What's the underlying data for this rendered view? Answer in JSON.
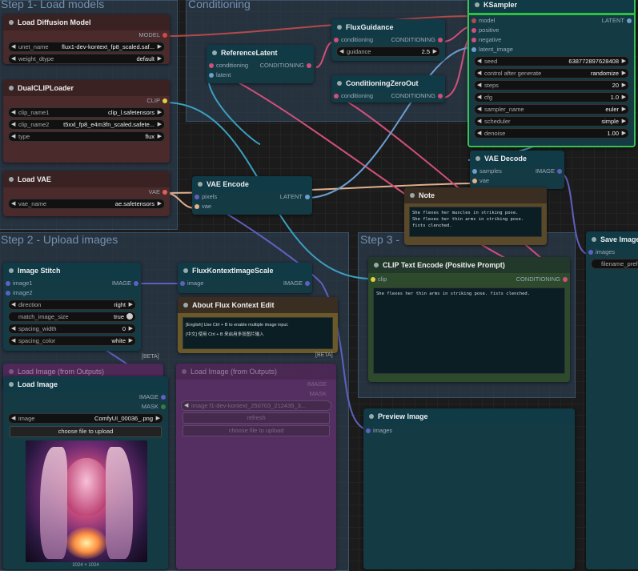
{
  "groups": {
    "step1": "Step 1- Load models",
    "conditioning": "Conditioning",
    "step2": "Step 2 - Upload images",
    "step3": "Step 3 -"
  },
  "load_diffusion": {
    "title": "Load Diffusion Model",
    "out": "MODEL",
    "unet_label": "unet_name",
    "unet_value": "flux1-dev-kontext_fp8_scaled.saf...",
    "dtype_label": "weight_dtype",
    "dtype_value": "default"
  },
  "dual_clip": {
    "title": "DualCLIPLoader",
    "out": "CLIP",
    "clip1_label": "clip_name1",
    "clip1_value": "clip_l.safetensors",
    "clip2_label": "clip_name2",
    "clip2_value": "t5xxl_fp8_e4m3fn_scaled.safete...",
    "type_label": "type",
    "type_value": "flux"
  },
  "load_vae": {
    "title": "Load VAE",
    "out": "VAE",
    "vae_label": "vae_name",
    "vae_value": "ae.safetensors"
  },
  "reference_latent": {
    "title": "ReferenceLatent",
    "in1": "conditioning",
    "in2": "latent",
    "out": "CONDITIONING"
  },
  "flux_guidance": {
    "title": "FluxGuidance",
    "in": "conditioning",
    "out": "CONDITIONING",
    "g_label": "guidance",
    "g_value": "2.5"
  },
  "cond_zero": {
    "title": "ConditioningZeroOut",
    "in": "conditioning",
    "out": "CONDITIONING"
  },
  "ksampler": {
    "title": "KSampler",
    "in_model": "model",
    "in_pos": "positive",
    "in_neg": "negative",
    "in_latent": "latent_image",
    "out": "LATENT",
    "widgets": [
      {
        "label": "seed",
        "value": "638772897628408"
      },
      {
        "label": "control after generate",
        "value": "randomize"
      },
      {
        "label": "steps",
        "value": "20"
      },
      {
        "label": "cfg",
        "value": "1.0"
      },
      {
        "label": "sampler_name",
        "value": "euler"
      },
      {
        "label": "scheduler",
        "value": "simple"
      },
      {
        "label": "denoise",
        "value": "1.00"
      }
    ]
  },
  "vae_encode": {
    "title": "VAE Encode",
    "in1": "pixels",
    "in2": "vae",
    "out": "LATENT"
  },
  "vae_decode": {
    "title": "VAE Decode",
    "in1": "samples",
    "in2": "vae",
    "out": "IMAGE"
  },
  "note": {
    "title": "Note",
    "text": "She flexes her muscles in striking pose.\nShe flexes her thin arms in striking pose.\nfists clenched."
  },
  "save_image": {
    "title": "Save Image",
    "in": "images",
    "prefix_label": "filename_prefi"
  },
  "image_stitch": {
    "title": "Image Stitch",
    "in1": "image1",
    "in2": "image2",
    "out": "IMAGE",
    "direction_label": "direction",
    "direction_value": "right",
    "match_label": "match_image_size",
    "match_value": "true",
    "spacing_label": "spacing_width",
    "spacing_value": "0",
    "color_label": "spacing_color",
    "color_value": "white",
    "beta": "[BETA]"
  },
  "flux_scale": {
    "title": "FluxKontextImageScale",
    "in": "image",
    "out": "IMAGE"
  },
  "about": {
    "title": "About Flux Kontext Edit",
    "line1": "[English] Use Ctrl + B to enable multiple image input.",
    "line2": "[中文] 使用 Ctrl + B 来启用多张图片输入",
    "beta": "[BETA]"
  },
  "clip_text": {
    "title": "CLIP Text Encode (Positive Prompt)",
    "in": "clip",
    "out": "CONDITIONING",
    "text": "She flexes her thin arms in striking pose. fists clenched."
  },
  "load_image_outputs_1": {
    "title": "Load Image (from Outputs)"
  },
  "load_image_outputs_2": {
    "title": "Load Image (from Outputs)",
    "out1": "IMAGE",
    "out2": "MASK",
    "image_label": "image",
    "image_value": "f1-dev-kontext_250703_212435_3...",
    "refresh": "refresh",
    "choose": "choose file to upload"
  },
  "load_image": {
    "title": "Load Image",
    "out1": "IMAGE",
    "out2": "MASK",
    "image_label": "image",
    "image_value": "ComfyUI_00036_.png",
    "choose": "choose file to upload",
    "dims": "1024 × 1024"
  },
  "preview_image": {
    "title": "Preview Image",
    "in": "images"
  },
  "colors": {
    "model_wire": "#b44a4a",
    "clip_wire": "#3aa0c0",
    "vae_wire": "#e0b090",
    "cond_wire": "#d0507a",
    "latent_wire": "#6aa0d0",
    "image_wire": "#6060c0"
  }
}
